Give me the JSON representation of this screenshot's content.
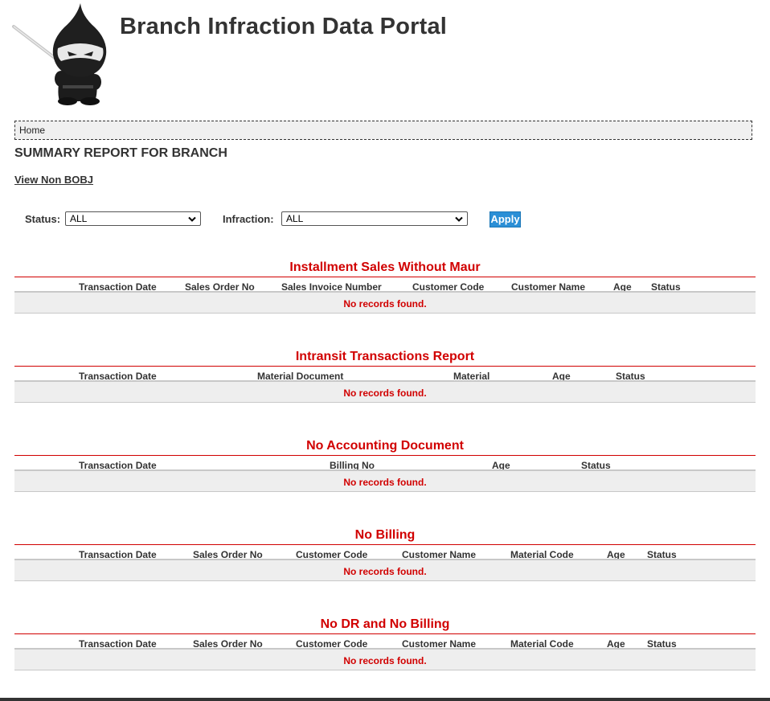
{
  "header": {
    "title": "Branch Infraction Data Portal"
  },
  "breadcrumb": {
    "home": "Home"
  },
  "page": {
    "title": "SUMMARY REPORT FOR BRANCH",
    "view_link": "View Non BOBJ"
  },
  "filters": {
    "status_label": "Status:",
    "status_value": "ALL",
    "infraction_label": "Infraction:",
    "infraction_value": "ALL",
    "apply_label": "Apply"
  },
  "reports": [
    {
      "title": "Installment Sales Without Maur",
      "columns": [
        "Transaction Date",
        "Sales Order No",
        "Sales Invoice Number",
        "Customer Code",
        "Customer Name",
        "Age",
        "Status"
      ],
      "empty_text": "No records found."
    },
    {
      "title": "Intransit Transactions Report",
      "columns": [
        "Transaction Date",
        "Material Document",
        "Material",
        "Age",
        "Status"
      ],
      "empty_text": "No records found."
    },
    {
      "title": "No Accounting Document",
      "columns": [
        "Transaction Date",
        "Billing No",
        "Age",
        "Status"
      ],
      "empty_text": "No records found."
    },
    {
      "title": "No Billing",
      "columns": [
        "Transaction Date",
        "Sales Order No",
        "Customer Code",
        "Customer Name",
        "Material Code",
        "Age",
        "Status"
      ],
      "empty_text": "No records found."
    },
    {
      "title": "No DR and No Billing",
      "columns": [
        "Transaction Date",
        "Sales Order No",
        "Customer Code",
        "Customer Name",
        "Material Code",
        "Age",
        "Status"
      ],
      "empty_text": "No records found."
    }
  ],
  "colors": {
    "accent_red": "#d10000",
    "apply_blue": "#2b8fd6"
  }
}
